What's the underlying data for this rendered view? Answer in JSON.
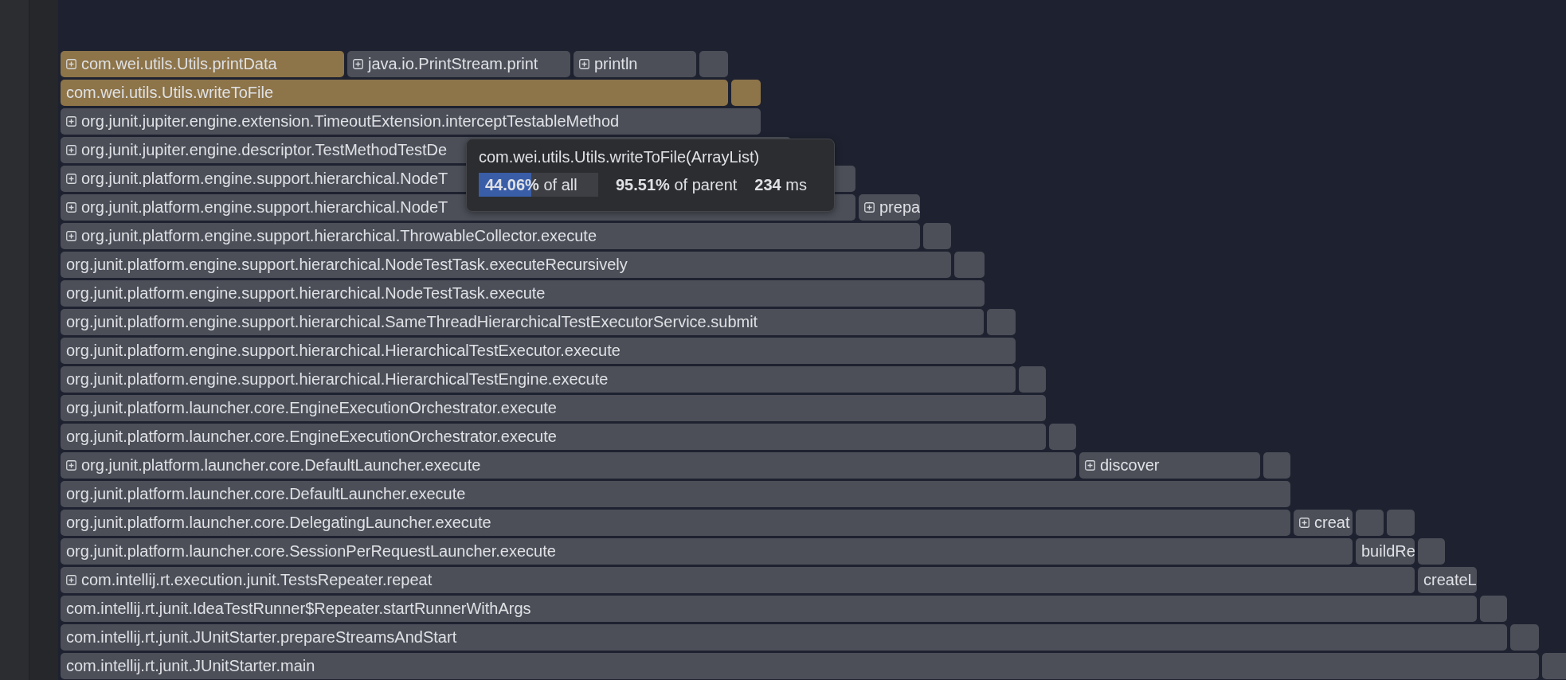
{
  "rows": [
    {
      "frames": [
        {
          "label": "com.wei.utils.Utils.printData",
          "expandable": true,
          "highlighted": true
        },
        {
          "label": "java.io.PrintStream.print",
          "expandable": true,
          "highlighted": false
        },
        {
          "label": "println",
          "expandable": true,
          "highlighted": false
        },
        {
          "expandable": false,
          "highlighted": false
        }
      ]
    },
    {
      "frames": [
        {
          "label": "com.wei.utils.Utils.writeToFile",
          "expandable": false,
          "highlighted": true
        },
        {
          "expandable": false,
          "highlighted": true
        }
      ]
    },
    {
      "frames": [
        {
          "label": "org.junit.jupiter.engine.extension.TimeoutExtension.interceptTestableMethod",
          "expandable": true,
          "highlighted": false
        }
      ]
    },
    {
      "frames": [
        {
          "label": "org.junit.jupiter.engine.descriptor.TestMethodTestDe",
          "expandable": true,
          "highlighted": false
        }
      ]
    },
    {
      "frames": [
        {
          "label": "org.junit.platform.engine.support.hierarchical.NodeT",
          "expandable": true,
          "highlighted": false
        }
      ]
    },
    {
      "frames": [
        {
          "label": "org.junit.platform.engine.support.hierarchical.NodeT",
          "expandable": true,
          "highlighted": false
        },
        {
          "label": "prepa",
          "expandable": true,
          "highlighted": false
        }
      ]
    },
    {
      "frames": [
        {
          "label": "org.junit.platform.engine.support.hierarchical.ThrowableCollector.execute",
          "expandable": true,
          "highlighted": false
        },
        {
          "expandable": false,
          "highlighted": false
        }
      ]
    },
    {
      "frames": [
        {
          "label": "org.junit.platform.engine.support.hierarchical.NodeTestTask.executeRecursively",
          "expandable": false,
          "highlighted": false
        },
        {
          "expandable": false,
          "highlighted": false
        }
      ]
    },
    {
      "frames": [
        {
          "label": "org.junit.platform.engine.support.hierarchical.NodeTestTask.execute",
          "expandable": false,
          "highlighted": false
        }
      ]
    },
    {
      "frames": [
        {
          "label": "org.junit.platform.engine.support.hierarchical.SameThreadHierarchicalTestExecutorService.submit",
          "expandable": false,
          "highlighted": false
        },
        {
          "expandable": false,
          "highlighted": false
        }
      ]
    },
    {
      "frames": [
        {
          "label": "org.junit.platform.engine.support.hierarchical.HierarchicalTestExecutor.execute",
          "expandable": false,
          "highlighted": false
        }
      ]
    },
    {
      "frames": [
        {
          "label": "org.junit.platform.engine.support.hierarchical.HierarchicalTestEngine.execute",
          "expandable": false,
          "highlighted": false
        },
        {
          "expandable": false,
          "highlighted": false
        }
      ]
    },
    {
      "frames": [
        {
          "label": "org.junit.platform.launcher.core.EngineExecutionOrchestrator.execute",
          "expandable": false,
          "highlighted": false
        }
      ]
    },
    {
      "frames": [
        {
          "label": "org.junit.platform.launcher.core.EngineExecutionOrchestrator.execute",
          "expandable": false,
          "highlighted": false
        },
        {
          "expandable": false,
          "highlighted": false
        }
      ]
    },
    {
      "frames": [
        {
          "label": "org.junit.platform.launcher.core.DefaultLauncher.execute",
          "expandable": true,
          "highlighted": false
        },
        {
          "label": "discover",
          "expandable": true,
          "highlighted": false
        },
        {
          "expandable": false,
          "highlighted": false
        }
      ]
    },
    {
      "frames": [
        {
          "label": "org.junit.platform.launcher.core.DefaultLauncher.execute",
          "expandable": false,
          "highlighted": false
        }
      ]
    },
    {
      "frames": [
        {
          "label": "org.junit.platform.launcher.core.DelegatingLauncher.execute",
          "expandable": false,
          "highlighted": false
        },
        {
          "label": "creat",
          "expandable": true,
          "highlighted": false
        },
        {
          "expandable": false,
          "highlighted": false
        },
        {
          "expandable": false,
          "highlighted": false
        }
      ]
    },
    {
      "frames": [
        {
          "label": "org.junit.platform.launcher.core.SessionPerRequestLauncher.execute",
          "expandable": false,
          "highlighted": false
        },
        {
          "label": "buildRe",
          "expandable": false,
          "highlighted": false
        },
        {
          "expandable": false,
          "highlighted": false
        }
      ]
    },
    {
      "frames": [
        {
          "label": "com.intellij.rt.execution.junit.TestsRepeater.repeat",
          "expandable": true,
          "highlighted": false
        },
        {
          "label": "createL",
          "expandable": false,
          "highlighted": false
        }
      ]
    },
    {
      "frames": [
        {
          "label": "com.intellij.rt.junit.IdeaTestRunner$Repeater.startRunnerWithArgs",
          "expandable": false,
          "highlighted": false
        },
        {
          "expandable": false,
          "highlighted": false
        }
      ]
    },
    {
      "frames": [
        {
          "label": "com.intellij.rt.junit.JUnitStarter.prepareStreamsAndStart",
          "expandable": false,
          "highlighted": false
        },
        {
          "expandable": false,
          "highlighted": false
        }
      ]
    },
    {
      "frames": [
        {
          "label": "com.intellij.rt.junit.JUnitStarter.main",
          "expandable": false,
          "highlighted": false
        },
        {
          "expandable": false,
          "highlighted": false
        }
      ]
    }
  ],
  "tooltip": {
    "title": "com.wei.utils.Utils.writeToFile(ArrayList)",
    "share_of_all": "**44.06%** of all",
    "level": 0.4406,
    "share_of_parent": "**95.51%** of parent",
    "duration": "**234** ms"
  }
}
